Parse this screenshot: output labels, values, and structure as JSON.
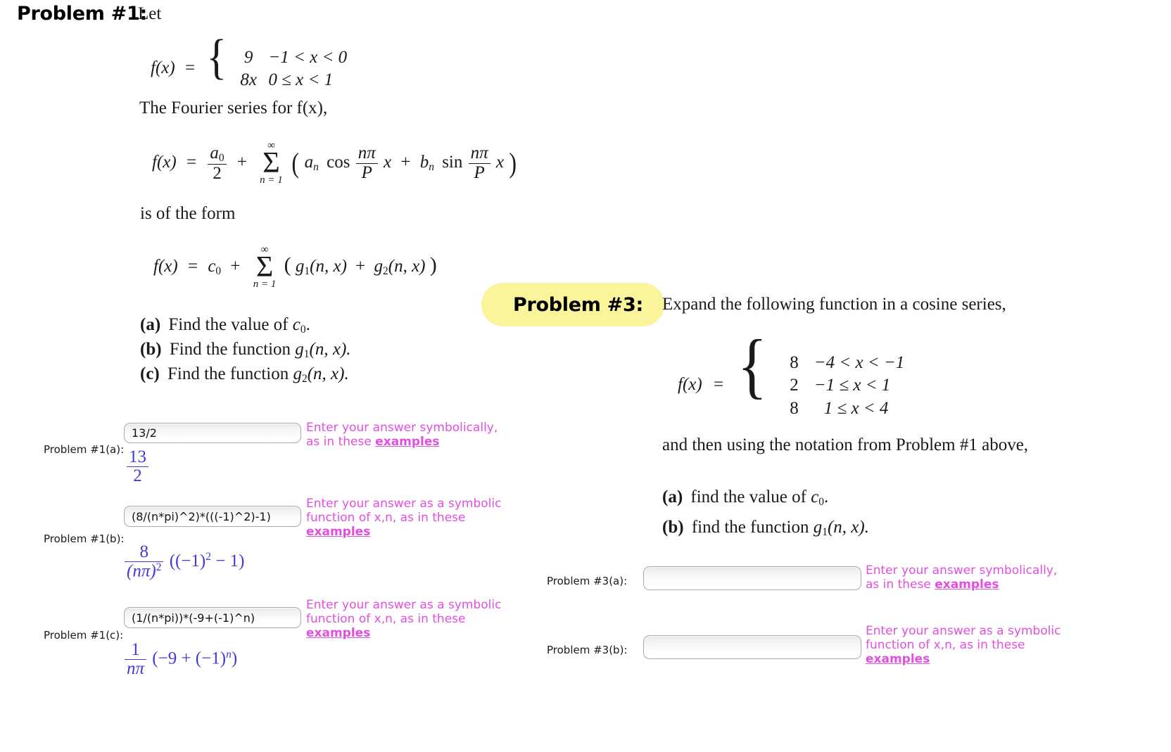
{
  "problem1": {
    "header_label": "Problem #1:",
    "intro": "Let",
    "piecewise": {
      "lhs": "f(x)",
      "eq": "=",
      "rows": [
        {
          "value": "9",
          "condition": "−1 < x < 0"
        },
        {
          "value": "8x",
          "condition": "0 ≤ x < 1"
        }
      ]
    },
    "fourier_intro": "The Fourier series for f(x),",
    "fourier_formula": {
      "lhs": "f(x)",
      "a0": "a",
      "a0_sub": "0",
      "denom": "2",
      "sum_upper": "∞",
      "sum_lower": "n = 1",
      "term1": "a",
      "term1_sub": "n",
      "cos": "cos",
      "cos_num": "nπ",
      "cos_den": "P",
      "term2": "b",
      "term2_sub": "n",
      "sin": "sin",
      "sin_num": "nπ",
      "sin_den": "P",
      "var": "x"
    },
    "form_intro": "is of the form",
    "form_formula": {
      "lhs": "f(x)",
      "c0": "c",
      "c0_sub": "0",
      "sum_upper": "∞",
      "sum_lower": "n = 1",
      "g1": "g",
      "g1_sub": "1",
      "g1_args": "(n, x)",
      "g2": "g",
      "g2_sub": "2",
      "g2_args": "(n, x)"
    },
    "parts": [
      {
        "tag": "(a)",
        "text_before": "Find the value of ",
        "sym": "c",
        "sym_sub": "0",
        "text_after": "."
      },
      {
        "tag": "(b)",
        "text_before": "Find the function ",
        "sym": "g",
        "sym_sub": "1",
        "text_after": "(n, x)."
      },
      {
        "tag": "(c)",
        "text_before": "Find the function ",
        "sym": "g",
        "sym_sub": "2",
        "text_after": "(n, x)."
      }
    ],
    "answers": [
      {
        "label": "Problem #1(a):",
        "value": "13/2",
        "placeholder": "",
        "hint_lines": [
          "Enter your answer symbolically,",
          "as in these "
        ],
        "hint_link": "examples",
        "rendered": {
          "kind": "fraction",
          "num": "13",
          "den": "2"
        }
      },
      {
        "label": "Problem #1(b):",
        "value": "(8/(n*pi)^2)*(((-1)^2)-1)",
        "placeholder": "",
        "hint_lines": [
          "Enter your answer as a symbolic",
          "function of x,n, as in these "
        ],
        "hint_link": "examples",
        "rendered": {
          "kind": "expr-b",
          "num": "8",
          "den_base": "(nπ)",
          "den_exp": "2",
          "tail_open": "((−1)",
          "tail_exp": "2",
          "tail_close": " − 1)"
        }
      },
      {
        "label": "Problem #1(c):",
        "value": "(1/(n*pi))*(-9+(-1)^n)",
        "placeholder": "",
        "hint_lines": [
          "Enter your answer as a symbolic",
          "function of x,n, as in these "
        ],
        "hint_link": "examples",
        "rendered": {
          "kind": "expr-c",
          "num": "1",
          "den": "nπ",
          "tail_open": "(−9 + (−1)",
          "tail_exp": "n",
          "tail_close": ")"
        }
      }
    ]
  },
  "problem3": {
    "header_label": "Problem #3:",
    "intro": "Expand the following function in a cosine series,",
    "piecewise": {
      "lhs": "f(x)",
      "eq": "=",
      "rows": [
        {
          "value": "8",
          "condition": "−4 < x < −1"
        },
        {
          "value": "2",
          "condition": "−1 ≤ x < 1"
        },
        {
          "value": "8",
          "condition": "1 ≤ x < 4"
        }
      ]
    },
    "notation_text": "and then using the notation from Problem #1 above,",
    "parts": [
      {
        "tag": "(a)",
        "text_before": "find the value of ",
        "sym": "c",
        "sym_sub": "0",
        "text_after": "."
      },
      {
        "tag": "(b)",
        "text_before": "find the function ",
        "sym": "g",
        "sym_sub": "1",
        "text_after": "(n, x)."
      }
    ],
    "answers": [
      {
        "label": "Problem #3(a):",
        "value": "",
        "placeholder": "",
        "hint_lines": [
          "Enter your answer symbolically,",
          "as in these "
        ],
        "hint_link": "examples"
      },
      {
        "label": "Problem #3(b):",
        "value": "",
        "placeholder": "",
        "hint_lines": [
          "Enter your answer as a symbolic",
          "function of x,n, as in these "
        ],
        "hint_link": "examples"
      }
    ]
  },
  "colors": {
    "highlight": "#faf49b",
    "hint": "#e24fe0",
    "rendered_answer": "#4338d8",
    "input_border": "#a9a9a9"
  }
}
